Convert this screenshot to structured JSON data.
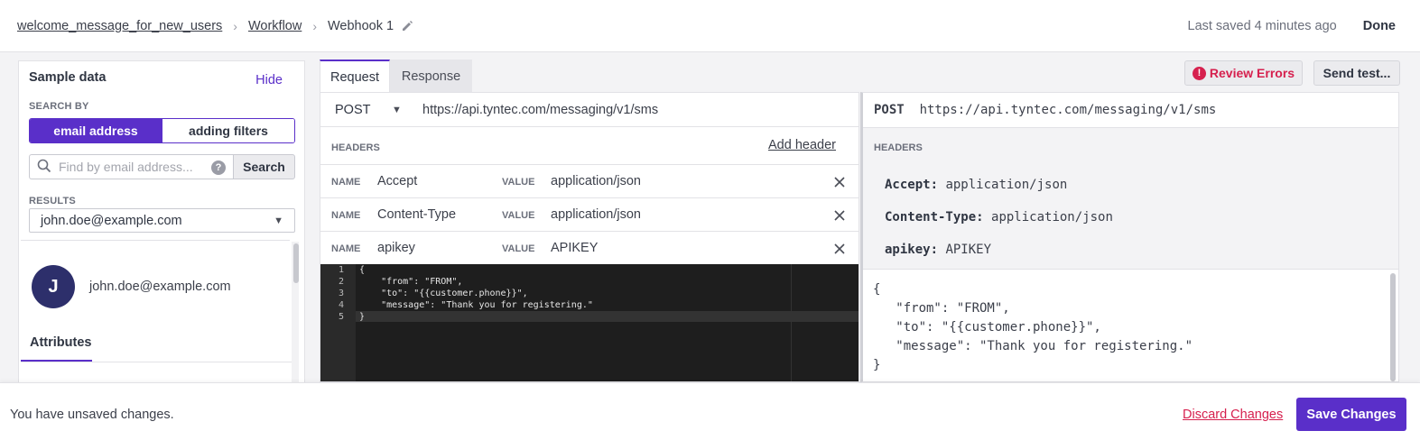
{
  "breadcrumb": {
    "items": [
      "welcome_message_for_new_users",
      "Workflow"
    ],
    "current": "Webhook 1",
    "separator": "›"
  },
  "header": {
    "last_saved": "Last saved 4 minutes ago",
    "done_label": "Done"
  },
  "sample_data": {
    "title": "Sample data",
    "hide_label": "Hide",
    "search_by_label": "SEARCH BY",
    "search_modes": [
      "email address",
      "adding filters"
    ],
    "search_placeholder": "Find by email address...",
    "search_button": "Search",
    "results_label": "RESULTS",
    "selected_result": "john.doe@example.com",
    "profile": {
      "initial": "J",
      "email": "john.doe@example.com"
    },
    "attributes_tab": "Attributes"
  },
  "tabs": {
    "request": "Request",
    "response": "Response"
  },
  "actions": {
    "review_errors": "Review Errors",
    "send_test": "Send test..."
  },
  "request": {
    "method": "POST",
    "url": "https://api.tyntec.com/messaging/v1/sms",
    "headers_label": "HEADERS",
    "add_header": "Add header",
    "name_label": "NAME",
    "value_label": "VALUE",
    "headers": [
      {
        "name": "Accept",
        "value": "application/json"
      },
      {
        "name": "Content-Type",
        "value": "application/json"
      },
      {
        "name": "apikey",
        "value": "APIKEY"
      }
    ],
    "body_lines": [
      "{",
      "    \"from\": \"FROM\",",
      "    \"to\": \"{{customer.phone}}\",",
      "    \"message\": \"Thank you for registering.\"",
      "}"
    ],
    "line_numbers": [
      "1",
      "2",
      "3",
      "4",
      "5"
    ]
  },
  "preview": {
    "method": "POST",
    "url": "https://api.tyntec.com/messaging/v1/sms",
    "headers_label": "HEADERS",
    "headers": [
      {
        "name": "Accept:",
        "value": "application/json"
      },
      {
        "name": "Content-Type:",
        "value": "application/json"
      },
      {
        "name": "apikey:",
        "value": "APIKEY"
      }
    ],
    "body": "{\n   \"from\": \"FROM\",\n   \"to\": \"{{customer.phone}}\",\n   \"message\": \"Thank you for registering.\"\n}"
  },
  "footer": {
    "unsaved_message": "You have unsaved changes.",
    "discard_label": "Discard Changes",
    "save_label": "Save Changes"
  },
  "colors": {
    "accent": "#5a2fc9",
    "error": "#d6204e",
    "avatar": "#2d2f6b"
  },
  "icons": {
    "edit": "pencil-icon",
    "search": "search-icon",
    "help": "help-icon",
    "dropdown": "caret-down-icon",
    "error": "alert-icon",
    "remove": "close-icon"
  }
}
